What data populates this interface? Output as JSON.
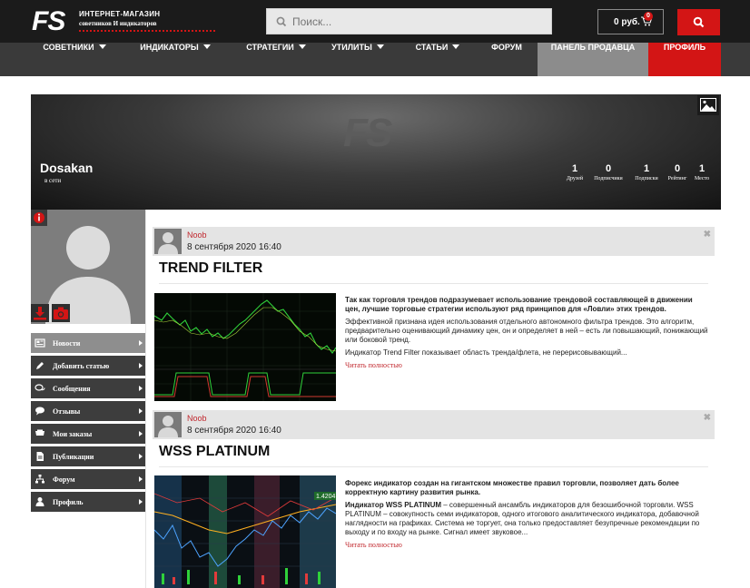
{
  "header": {
    "logo_mark": "FS",
    "logo_line1": "ИНТЕРНЕТ-МАГАЗИН",
    "logo_line2": "советников И индикаторов",
    "search_placeholder": "Поиск...",
    "cart_amount": "0 руб.",
    "cart_badge": "0"
  },
  "nav": {
    "items": [
      {
        "label": "СОВЕТНИКИ"
      },
      {
        "label": "ИНДИКАТОРЫ"
      },
      {
        "label": "СТРАТЕГИИ"
      },
      {
        "label": "УТИЛИТЫ"
      },
      {
        "label": "СТАТЬИ"
      },
      {
        "label": "ФОРУМ"
      },
      {
        "label": "ПАНЕЛЬ ПРОДАВЦА"
      },
      {
        "label": "ПРОФИЛЬ"
      }
    ]
  },
  "cover": {
    "watermark": "FS",
    "username": "Dosakan",
    "status": "в сети",
    "stats": [
      {
        "value": "1",
        "label": "Друзей"
      },
      {
        "value": "0",
        "label": "Подписчики"
      },
      {
        "value": "1",
        "label": "Подписки"
      },
      {
        "value": "0",
        "label": "Рейтинг"
      },
      {
        "value": "1",
        "label": "Место"
      }
    ]
  },
  "sidebar": {
    "items": [
      {
        "label": "Новости",
        "icon": "newspaper-icon"
      },
      {
        "label": "Добавить статью",
        "icon": "pencil-icon"
      },
      {
        "label": "Сообщения",
        "icon": "chat-icon"
      },
      {
        "label": "Отзывы",
        "icon": "comment-icon"
      },
      {
        "label": "Мои заказы",
        "icon": "cart-icon"
      },
      {
        "label": "Публикации",
        "icon": "document-icon"
      },
      {
        "label": "Форум",
        "icon": "sitemap-icon"
      },
      {
        "label": "Профиль",
        "icon": "user-icon"
      }
    ]
  },
  "posts": [
    {
      "author": "Noob",
      "date": "8 сентября 2020 16:40",
      "title": "TREND FILTER",
      "lead": "Так как торговля трендов подразумевает использование трендовой составляющей в движении цен, лучшие торговые стратегии используют ряд принципов для «Ловли» этих трендов.",
      "p1": "Эффективной признана идея использования отдельного автономного фильтра трендов. Это алгоритм, предварительно оценивающий динамику цен, он и определяет в ней – есть ли повышающий, понижающий или боковой тренд.",
      "p2": "Индикатор Trend Filter показывает область тренда/флета, не перерисовывающий...",
      "more": "Читать полностью"
    },
    {
      "author": "Noob",
      "date": "8 сентября 2020 16:40",
      "title": "WSS PLATINUM",
      "lead": "Форекс индикатор создан на гигантском множестве правил торговли, позволяет дать более корректную картину развития рынка.",
      "p1_bold": "Индикатор WSS PLATINUM",
      "p1": " – совершенный ансамбль индикаторов для безошибочной торговли. WSS PLATINUM – совокупность семи индикаторов, одного итогового аналитического индикатора, добавочной наглядности на графиках. Система не торгует, она только предоставляет безупречные рекомендации по выходу и по входу на рынке. Сигнал имеет звуковое...",
      "more": "Читать полностью",
      "chart_price": "1.4204"
    }
  ],
  "colors": {
    "accent": "#d31515",
    "header_bg": "#1b1b1b",
    "nav_bg": "#3a3a3a",
    "seller_bg": "#8c8c8c",
    "link": "#c1272d"
  }
}
